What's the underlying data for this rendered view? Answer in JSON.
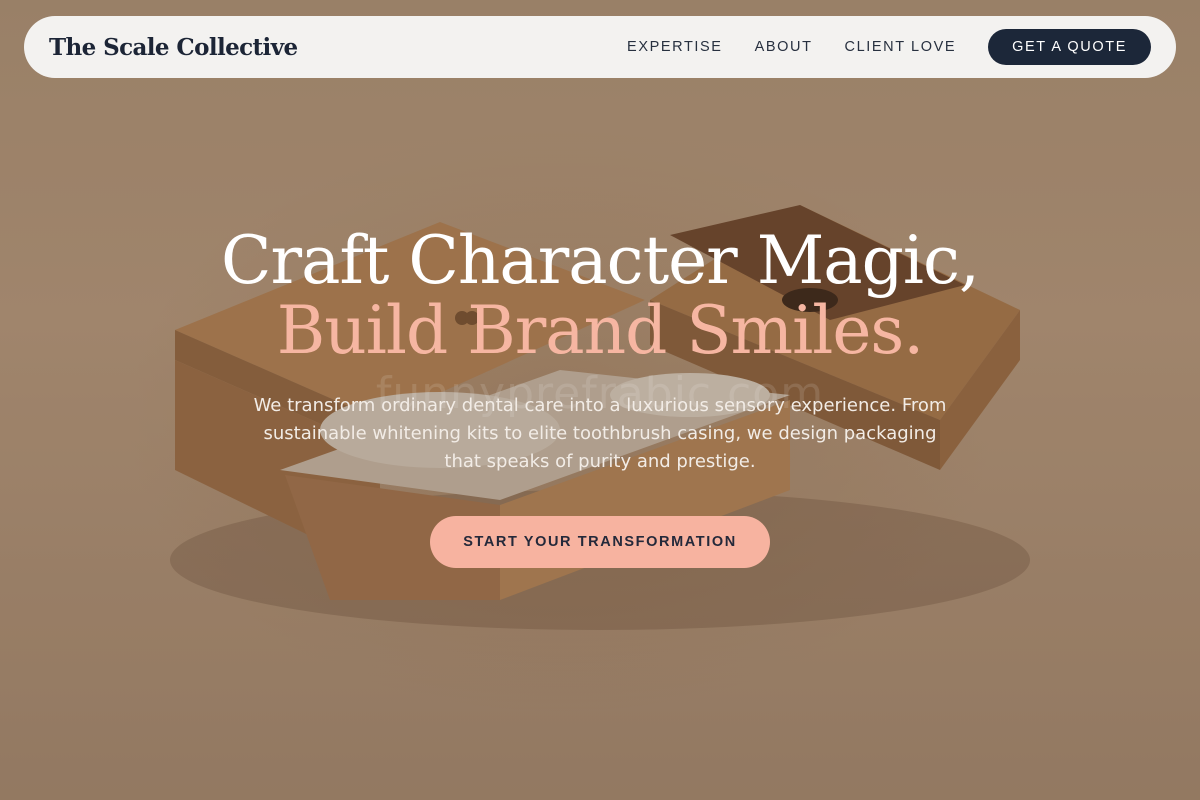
{
  "nav": {
    "brand": "The Scale Collective",
    "links": [
      {
        "label": "EXPERTISE"
      },
      {
        "label": "ABOUT"
      },
      {
        "label": "CLIENT LOVE"
      }
    ],
    "cta": "GET A QUOTE"
  },
  "hero": {
    "headline_line1": "Craft Character Magic,",
    "headline_line2": "Build Brand Smiles.",
    "subtext": "We transform ordinary dental care into a luxurious sensory experience. From sustainable whitening kits to elite toothbrush casing, we design packaging that speaks of purity and prestige.",
    "cta": "START YOUR TRANSFORMATION",
    "watermark": "funnyprefrabic.com"
  },
  "colors": {
    "nav_background": "#f3f2f0",
    "brand_navy": "#1c2739",
    "accent_peach": "#f7b3a0",
    "headline_peach": "#f6b6a2",
    "background_kraft": "#b69a7e"
  }
}
